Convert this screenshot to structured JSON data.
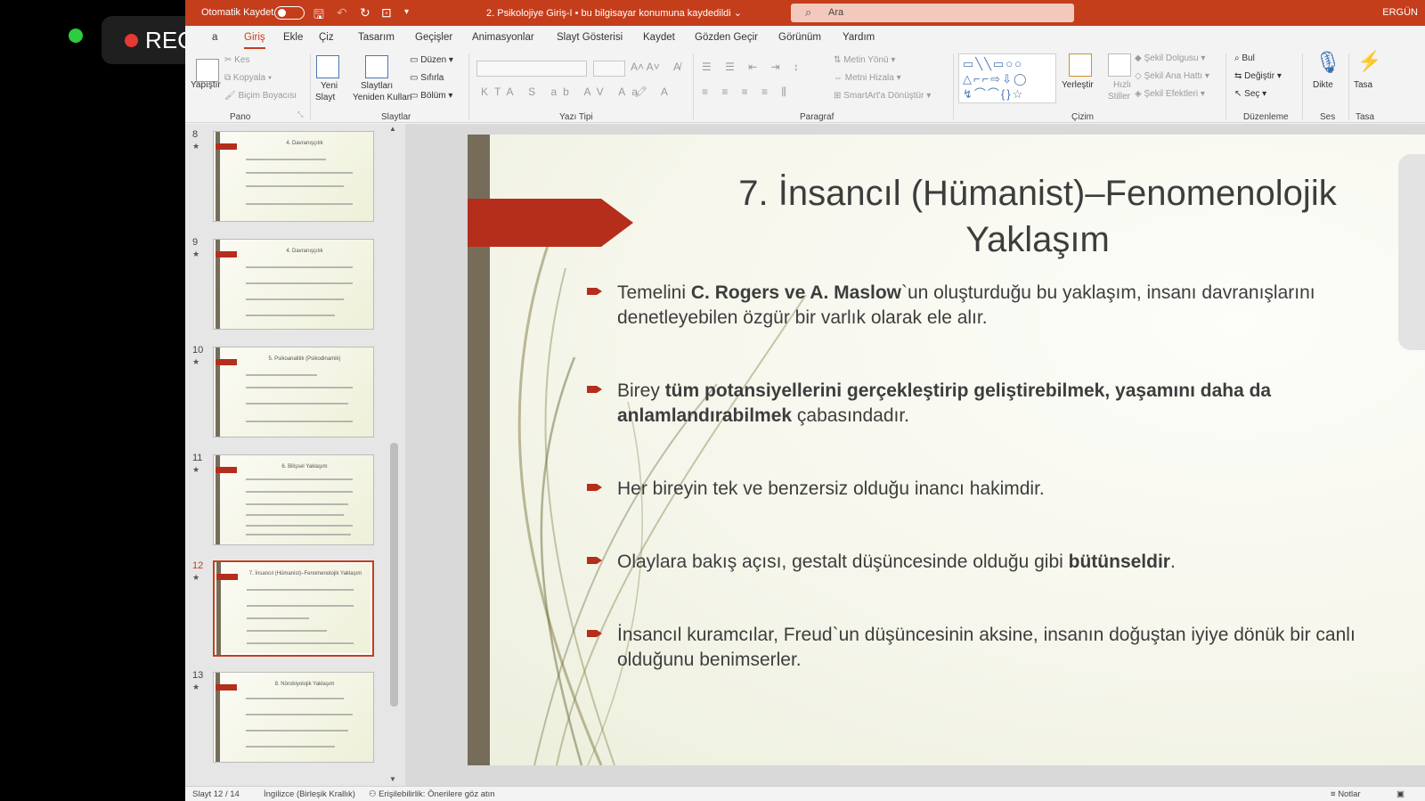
{
  "recording": {
    "label": "REC"
  },
  "titlebar": {
    "autosave_label": "Otomatik Kaydet",
    "document_title": "2. Psikolojiye Giriş-I  •  bu bilgisayar konumuna kaydedildi",
    "search_placeholder": "Ara",
    "user_name": "ERGÜN"
  },
  "menu": {
    "tabs": [
      "a",
      "Giriş",
      "Ekle",
      "Çiz",
      "Tasarım",
      "Geçişler",
      "Animasyonlar",
      "Slayt Gösterisi",
      "Kaydet",
      "Gözden Geçir",
      "Görünüm",
      "Yardım"
    ],
    "active": "Giriş"
  },
  "ribbon": {
    "pano": {
      "label": "Pano",
      "paste": "Yapıştır",
      "cut": "Kes",
      "copy": "Kopyala",
      "format_painter": "Biçim Boyacısı"
    },
    "slaytlar": {
      "label": "Slaytlar",
      "new_slide_1": "Yeni",
      "new_slide_2": "Slayt",
      "reuse_1": "Slaytları",
      "reuse_2": "Yeniden Kullan",
      "layout": "Düzen",
      "reset": "Sıfırla",
      "section": "Bölüm"
    },
    "yazi_tipi": {
      "label": "Yazı Tipi"
    },
    "paragraf": {
      "label": "Paragraf",
      "text_direction": "Metin Yönü",
      "align_text": "Metni Hizala",
      "smartart": "SmartArt'a Dönüştür"
    },
    "cizim": {
      "label": "Çizim",
      "arrange": "Yerleştir",
      "quick_styles_1": "Hızlı",
      "quick_styles_2": "Stiller",
      "fill": "Şekil Dolgusu",
      "outline": "Şekil Ana Hattı",
      "effects": "Şekil Efektleri"
    },
    "duzenleme": {
      "label": "Düzenleme",
      "find": "Bul",
      "replace": "Değiştir",
      "select": "Seç"
    },
    "ses": {
      "label": "Ses",
      "dictate": "Dikte"
    },
    "tasarimci": {
      "label": "Tasa",
      "button": "Tasa"
    }
  },
  "thumbnails": [
    {
      "num": "8",
      "title": "4. Davranışçılık"
    },
    {
      "num": "9",
      "title": "4. Davranışçılık"
    },
    {
      "num": "10",
      "title": "5. Psikoanalitik (Psikodinamik)"
    },
    {
      "num": "11",
      "title": "6. Bilişsel Yaklaşım"
    },
    {
      "num": "12",
      "title": "7. İnsancıl (Hümanist)–Fenomenolojik Yaklaşım"
    },
    {
      "num": "13",
      "title": "8. Nörobiyolojik Yaklaşım"
    }
  ],
  "slide": {
    "title_line1": "7. İnsancıl (Hümanist)–Fenomenolojik",
    "title_line2": "Yaklaşım",
    "bullets": [
      {
        "pre": "Temelini ",
        "bold": "C. Rogers ve A. Maslow",
        "post": "`un oluşturduğu bu yaklaşım, insanı davranışlarını denetleyebilen özgür bir varlık olarak ele alır."
      },
      {
        "pre": "Birey ",
        "bold": "tüm potansiyellerini gerçekleştirip geliştirebilmek, yaşamını daha da anlamlandırabilmek",
        "post": " çabasındadır."
      },
      {
        "pre": "Her bireyin tek ve benzersiz olduğu inancı hakimdir.",
        "bold": "",
        "post": ""
      },
      {
        "pre": "Olaylara bakış açısı, gestalt düşüncesinde olduğu gibi ",
        "bold": "bütünseldir",
        "post": "."
      },
      {
        "pre": "İnsancıl kuramcılar, Freud`un düşüncesinin aksine, insanın doğuştan iyiye dönük bir canlı olduğunu benimserler.",
        "bold": "",
        "post": ""
      }
    ]
  },
  "statusbar": {
    "slide_counter": "Slayt 12 / 14",
    "language": "İngilizce (Birleşik Krallık)",
    "accessibility": "Erişilebilirlik: Önerilere göz atın",
    "notes": "Notlar"
  },
  "colors": {
    "accent": "#c43e1c",
    "slide_arrow": "#b42e1b",
    "slide_bar": "#756d5a"
  }
}
